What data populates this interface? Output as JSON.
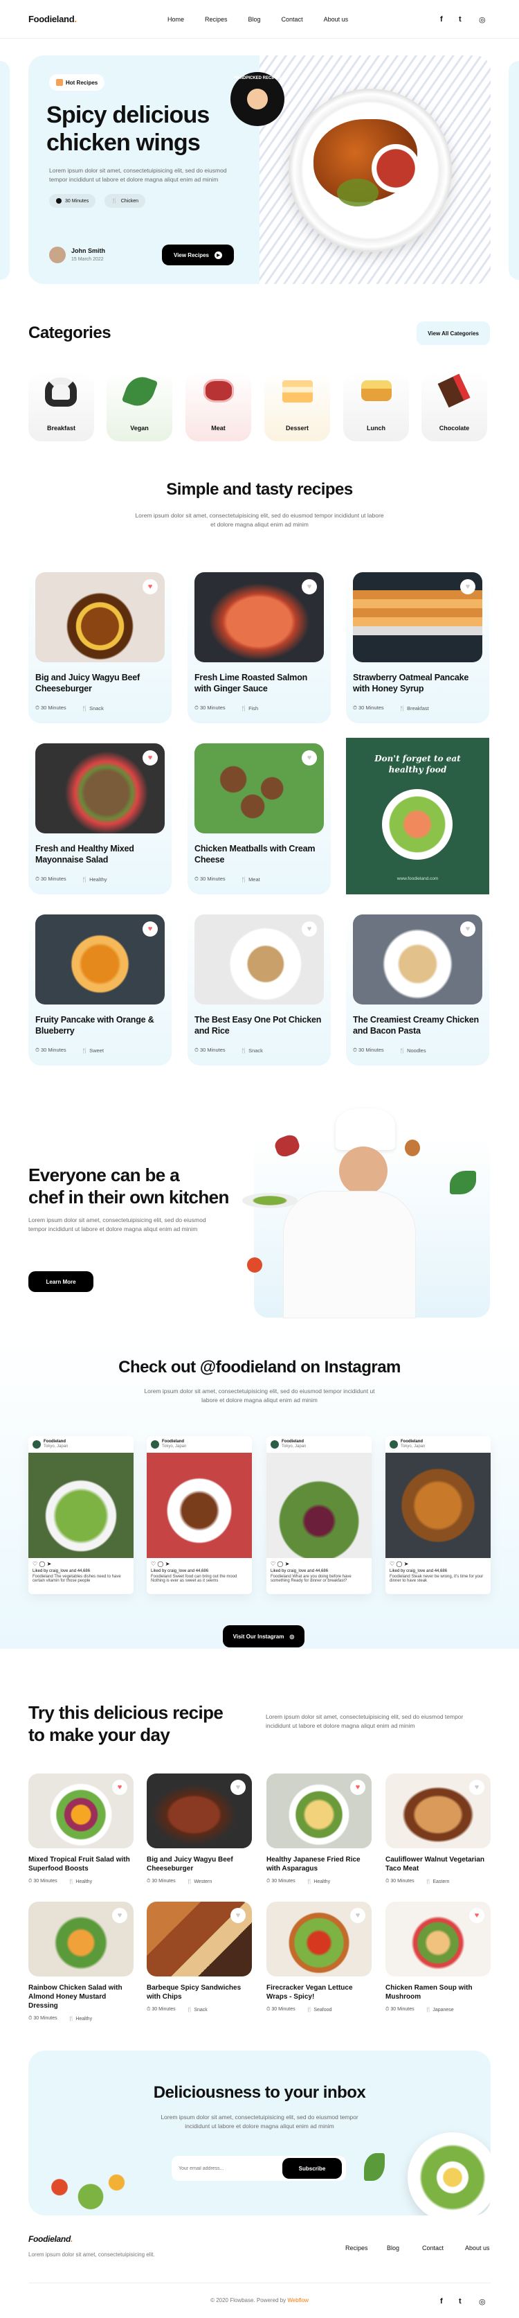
{
  "brand": {
    "name": "Foodieland",
    "dot": "."
  },
  "nav": {
    "links": [
      "Home",
      "Recipes",
      "Blog",
      "Contact",
      "About us"
    ]
  },
  "social": {
    "icons": [
      "facebook-icon",
      "twitter-icon",
      "instagram-icon"
    ],
    "glyphs": [
      "f",
      "t",
      "◎"
    ]
  },
  "hero": {
    "badge": "Hot Recipes",
    "title_line1": "Spicy delicious",
    "title_line2": "chicken wings",
    "desc": "Lorem ipsum dolor sit amet, consectetuipisicing elit, sed do eiusmod tempor incididunt ut labore et dolore magna aliqut enim ad minim",
    "time": "30 Minutes",
    "category": "Chicken",
    "author": "John Smith",
    "date": "15 March 2022",
    "cta": "View Recipes",
    "stamp": "HANDPICKED RECIPES"
  },
  "categories": {
    "title": "Categories",
    "view_all": "View All Categories",
    "items": [
      {
        "label": "Breakfast",
        "color": "#f3f3f3"
      },
      {
        "label": "Vegan",
        "color": "#eef5ea"
      },
      {
        "label": "Meat",
        "color": "#fdecec"
      },
      {
        "label": "Dessert",
        "color": "#fdf6e7"
      },
      {
        "label": "Lunch",
        "color": "#f4f4f4"
      },
      {
        "label": "Chocolate",
        "color": "#f4f4f4"
      }
    ]
  },
  "simple": {
    "title": "Simple and tasty recipes",
    "desc": "Lorem ipsum dolor sit amet, consectetuipisicing elit, sed do eiusmod tempor incididunt ut labore et dolore magna aliqut enim ad minim",
    "cards": [
      {
        "title": "Big and Juicy Wagyu Beef Cheeseburger",
        "time": "30 Minutes",
        "tag": "Snack",
        "liked": true
      },
      {
        "title": "Fresh Lime Roasted Salmon with Ginger Sauce",
        "time": "30 Minutes",
        "tag": "Fish",
        "liked": false
      },
      {
        "title": "Strawberry Oatmeal Pancake with Honey Syrup",
        "time": "30 Minutes",
        "tag": "Breakfast",
        "liked": false
      },
      {
        "title": "Fresh and Healthy Mixed Mayonnaise Salad",
        "time": "30 Minutes",
        "tag": "Healthy",
        "liked": true
      },
      {
        "title": "Chicken Meatballs with Cream Cheese",
        "time": "30 Minutes",
        "tag": "Meat",
        "liked": false
      },
      {
        "title": "Fruity Pancake with Orange & Blueberry",
        "time": "30 Minutes",
        "tag": "Sweet",
        "liked": true
      },
      {
        "title": "The Best Easy One Pot Chicken and Rice",
        "time": "30 Minutes",
        "tag": "Snack",
        "liked": false
      },
      {
        "title": "The Creamiest Creamy Chicken and Bacon Pasta",
        "time": "30 Minutes",
        "tag": "Noodles",
        "liked": false
      }
    ],
    "ad": {
      "line1": "Don't forget to eat",
      "line2": "healthy food",
      "url": "www.foodieland.com"
    }
  },
  "chef": {
    "title_line1": "Everyone can be a",
    "title_line2": "chef in their own kitchen",
    "desc": "Lorem ipsum dolor sit amet, consectetuipisicing elit, sed do eiusmod tempor incididunt ut labore et dolore magna aliqut enim ad minim",
    "cta": "Learn More"
  },
  "instagram": {
    "title": "Check out @foodieland on Instagram",
    "desc": "Lorem ipsum dolor sit amet, consectetuipisicing elit, sed do eiusmod tempor incididunt ut labore et dolore magna aliqut enim ad minim",
    "cta": "Visit Our Instagram",
    "posts": [
      {
        "user": "Foodieland",
        "loc": "Tokyo, Japan",
        "likes": "Liked by craig_love and 44,686",
        "text": "Foodieland The vegetables dishes need to have certain vitamin for those people"
      },
      {
        "user": "Foodieland",
        "loc": "Tokyo, Japan",
        "likes": "Liked by craig_love and 44,686",
        "text": "Foodieland Sweet food can bring out the mood Nothing is ever as sweet as it seems"
      },
      {
        "user": "Foodieland",
        "loc": "Tokyo, Japan",
        "likes": "Liked by craig_love and 44,686",
        "text": "Foodieland What are you doing before have something Ready for dinner or breakfast?"
      },
      {
        "user": "Foodieland",
        "loc": "Tokyo, Japan",
        "likes": "Liked by craig_love and 44,686",
        "text": "Foodieland Steak never be wrong, it's time for your dinner to have steak"
      }
    ]
  },
  "try": {
    "title_line1": "Try this delicious recipe",
    "title_line2": "to make your day",
    "desc": "Lorem ipsum dolor sit amet, consectetuipisicing elit, sed do eiusmod tempor incididunt ut labore et dolore magna aliqut enim ad minim",
    "cards": [
      {
        "title": "Mixed Tropical Fruit Salad with Superfood Boosts",
        "time": "30 Minutes",
        "tag": "Healthy",
        "liked": true
      },
      {
        "title": "Big and Juicy Wagyu Beef Cheeseburger",
        "time": "30 Minutes",
        "tag": "Western",
        "liked": false
      },
      {
        "title": "Healthy Japanese Fried Rice with Asparagus",
        "time": "30 Minutes",
        "tag": "Healthy",
        "liked": true
      },
      {
        "title": "Cauliflower Walnut Vegetarian Taco Meat",
        "time": "30 Minutes",
        "tag": "Eastern",
        "liked": false
      },
      {
        "title": "Rainbow Chicken Salad with Almond Honey Mustard Dressing",
        "time": "30 Minutes",
        "tag": "Healthy",
        "liked": false
      },
      {
        "title": "Barbeque Spicy Sandwiches with Chips",
        "time": "30 Minutes",
        "tag": "Snack",
        "liked": false
      },
      {
        "title": "Firecracker Vegan Lettuce Wraps - Spicy!",
        "time": "30 Minutes",
        "tag": "Seafood",
        "liked": false
      },
      {
        "title": "Chicken Ramen Soup with Mushroom",
        "time": "30 Minutes",
        "tag": "Japanese",
        "liked": true
      }
    ]
  },
  "newsletter": {
    "title": "Deliciousness to your inbox",
    "desc": "Lorem ipsum dolor sit amet, consectetuipisicing elit, sed do eiusmod tempor incididunt ut labore et dolore magna aliqut enim ad minim",
    "placeholder": "Your email address...",
    "cta": "Subscribe"
  },
  "footer": {
    "desc": "Lorem ipsum dolor sit amet, consectetuipisicing elit.",
    "links": [
      "Recipes",
      "Blog",
      "Contact",
      "About us"
    ],
    "copyright": "© 2020 Flowbase. Powered by",
    "powered": "Webflow"
  },
  "colors": {
    "accent": "#ff7a00",
    "light_blue": "#e8f7fc",
    "ad_green": "#2b5f45",
    "heart_red": "#ff6363"
  }
}
